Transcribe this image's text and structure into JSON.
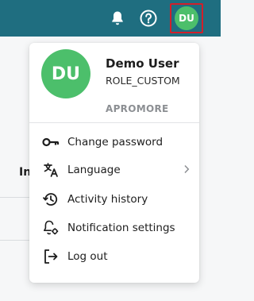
{
  "user": {
    "initials": "DU",
    "name": "Demo User",
    "role": "ROLE_CUSTOM",
    "organization": "APROMORE"
  },
  "menu_items": [
    {
      "label": "Change password",
      "icon": "key-icon"
    },
    {
      "label": "Language",
      "icon": "translate-icon",
      "has_submenu": true
    },
    {
      "label": "Activity history",
      "icon": "history-icon"
    },
    {
      "label": "Notification settings",
      "icon": "notification-settings-icon"
    },
    {
      "label": "Log out",
      "icon": "logout-icon"
    }
  ],
  "background": {
    "partial_text": "In"
  },
  "colors": {
    "topbar": "#1f6e80",
    "avatar": "#4cbf6b",
    "highlight_border": "#d21f2a",
    "muted_text": "#8c8f93"
  }
}
